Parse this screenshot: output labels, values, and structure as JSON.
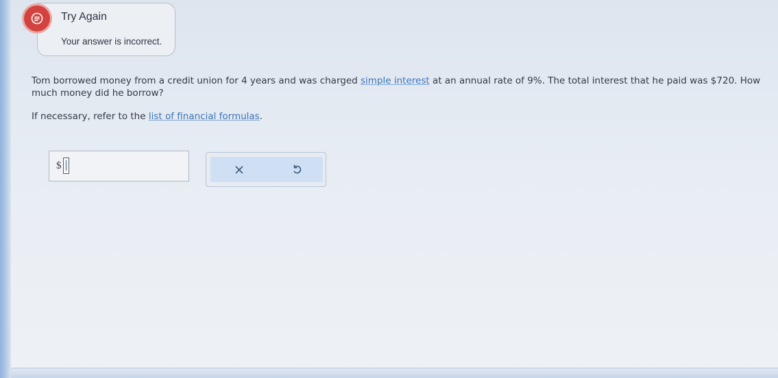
{
  "feedback": {
    "title": "Try Again",
    "message": "Your answer is incorrect."
  },
  "question": {
    "part1": "Tom borrowed money from a credit union for 4 years and was charged ",
    "link": "simple interest",
    "part2": " at an annual rate of 9%. The total interest that he paid was $720. How much money did he borrow?"
  },
  "refer": {
    "prefix": "If necessary, refer to the ",
    "link": "list of financial formulas",
    "suffix": "."
  },
  "answer": {
    "currency": "$",
    "value": ""
  },
  "actions": {
    "clear_icon": "x-icon",
    "undo_icon": "undo-icon"
  },
  "colors": {
    "alert": "#d2433f",
    "link": "#3a74b8",
    "action_bg": "#cfe0f4",
    "action_icon": "#3f5a7e"
  }
}
